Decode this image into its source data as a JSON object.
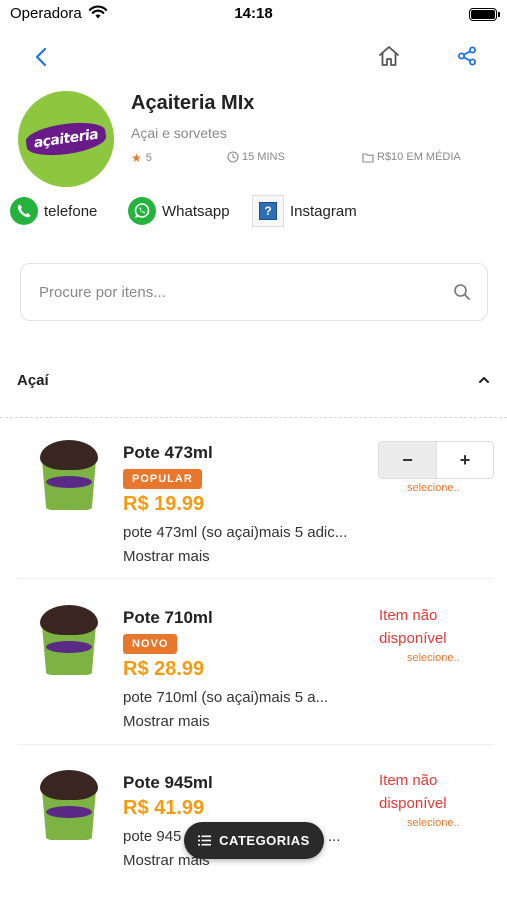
{
  "status_bar": {
    "carrier": "Operadora",
    "time": "14:18"
  },
  "store": {
    "logo_text": "açaiteria",
    "name": "Açaiteria MIx",
    "description": "Açai e sorvetes",
    "rating": "5",
    "delivery_time": "15 MINS",
    "price_range": "R$10 EM MÉDIA"
  },
  "contacts": {
    "phone_label": "telefone",
    "whatsapp_label": "Whatsapp",
    "instagram_label": "Instagram",
    "instagram_placeholder_glyph": "?"
  },
  "search": {
    "placeholder": "Procure por itens..."
  },
  "category": {
    "title": "Açaí"
  },
  "products": [
    {
      "name": "Pote 473ml",
      "badge": "POPULAR",
      "price": "R$ 19.99",
      "description": "pote 473ml (so açai)mais 5 adic...",
      "more": "Mostrar mais",
      "available": true,
      "stepper_minus": "−",
      "stepper_plus": "+",
      "select_hint": "selecione.."
    },
    {
      "name": "Pote 710ml",
      "badge": "NOVO",
      "price": "R$ 28.99",
      "description": "pote 710ml (so açai)mais 5 a...",
      "more": "Mostrar mais",
      "available": false,
      "unavailable_text": "Item não disponível",
      "select_hint": "selecione.."
    },
    {
      "name": "Pote 945ml",
      "price": "R$ 41.99",
      "description": "pote 945",
      "description_tail": "...",
      "more": "Mostrar mais",
      "available": false,
      "unavailable_text": "Item não disponível",
      "select_hint": "selecione.."
    }
  ],
  "categories_button": {
    "label": "CATEGORIAS"
  },
  "colors": {
    "accent_orange": "#e8772e",
    "price_orange": "#f39c12",
    "unavailable_red": "#e53935",
    "nav_blue": "#1a73e8",
    "whatsapp_green": "#25b33e",
    "brand_purple": "#6a1b8a",
    "brand_green": "#8dc63f"
  },
  "icons": [
    "wifi-icon",
    "battery-icon",
    "back-icon",
    "home-icon",
    "share-icon",
    "star-icon",
    "clock-icon",
    "folder-icon",
    "phone-icon",
    "whatsapp-icon",
    "instagram-icon",
    "search-icon",
    "chevron-up-icon",
    "list-icon"
  ]
}
